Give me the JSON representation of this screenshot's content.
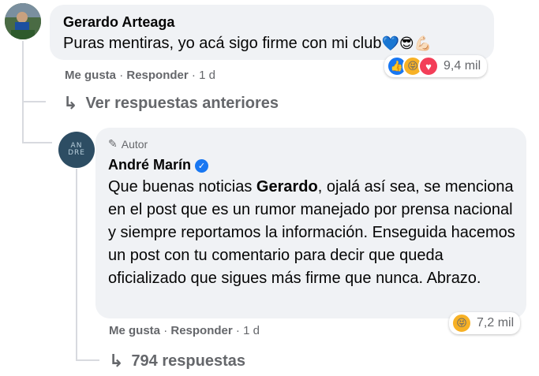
{
  "comment1": {
    "author": "Gerardo Arteaga",
    "text": "Puras mentiras, yo acá sigo firme con mi club",
    "emoji": "💙😎💪🏻",
    "reaction_count": "9,4 mil",
    "like": "Me gusta",
    "reply": "Responder",
    "separator": "·",
    "time": "1 d"
  },
  "view_previous": "Ver respuestas anteriores",
  "reply1": {
    "badge": "Autor",
    "author": "André Marín",
    "avatar_text": "AN\nDRE",
    "text_part1": "Que buenas noticias ",
    "text_bold": "Gerardo",
    "text_part2": ", ojalá así sea, se menciona en el post que es un rumor manejado por prensa nacional y siempre reportamos la información. Enseguida hacemos un post con tu comentario para decir que queda oficializado que sigues más firme que nunca. Abrazo.",
    "reaction_count": "7,2 mil",
    "like": "Me gusta",
    "reply": "Responder",
    "separator": "·",
    "time": "1 d"
  },
  "replies_link": "794 respuestas",
  "colors": {
    "bubble": "#f0f2f5",
    "meta": "#65676b",
    "blue": "#1877f2"
  }
}
